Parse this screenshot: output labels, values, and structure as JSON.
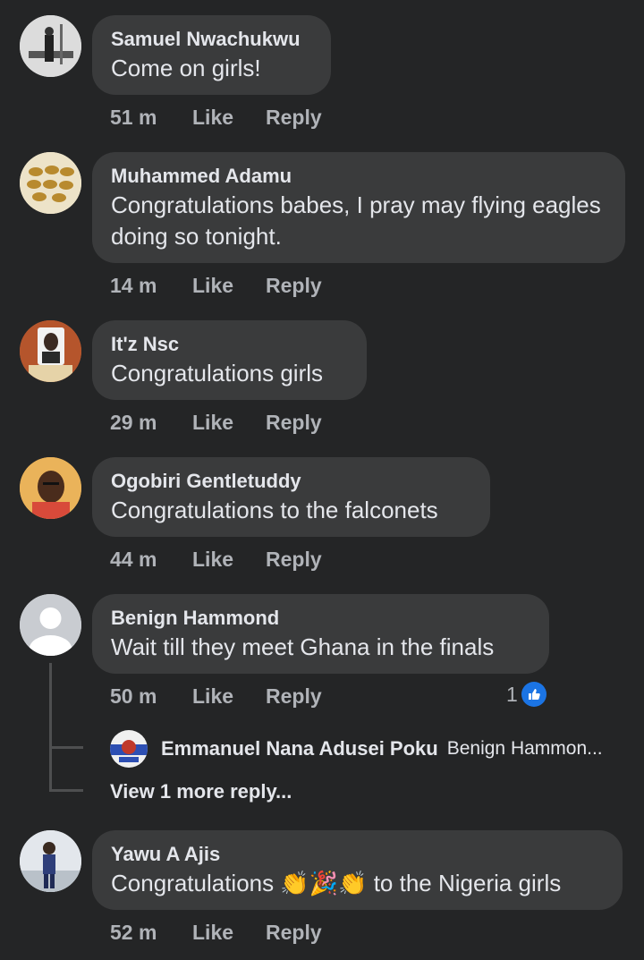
{
  "comments": [
    {
      "name": "Samuel Nwachukwu",
      "text": "Come on girls!",
      "time": "51 m",
      "like": "Like",
      "reply": "Reply"
    },
    {
      "name": "Muhammed Adamu",
      "text": "Congratulations babes, I pray may flying eagles doing so tonight.",
      "time": "14 m",
      "like": "Like",
      "reply": "Reply"
    },
    {
      "name": "It'z Nsc",
      "text": "Congratulations girls",
      "time": "29 m",
      "like": "Like",
      "reply": "Reply"
    },
    {
      "name": "Ogobiri Gentletuddy",
      "text": "Congratulations to the falconets",
      "time": "44 m",
      "like": "Like",
      "reply": "Reply"
    },
    {
      "name": "Benign Hammond",
      "text": "Wait till they meet Ghana in the finals",
      "time": "50 m",
      "like": "Like",
      "reply": "Reply",
      "reaction_count": "1"
    },
    {
      "name": "Yawu A Ajis",
      "text_before": "Congratulations ",
      "emoji": "👏🎉👏",
      "text_after": " to the Nigeria girls",
      "time": "52 m",
      "like": "Like",
      "reply": "Reply"
    }
  ],
  "reply": {
    "name": "Emmanuel Nana Adusei Poku",
    "snippet": "Benign Hammon..."
  },
  "view_more": "View 1 more reply...",
  "colors": {
    "background": "#242526",
    "bubble": "#3a3b3c",
    "text": "#e4e6eb",
    "muted": "#b0b3b8",
    "like_blue": "#1b74e4"
  },
  "icons": [
    "thumbs-up-icon"
  ]
}
